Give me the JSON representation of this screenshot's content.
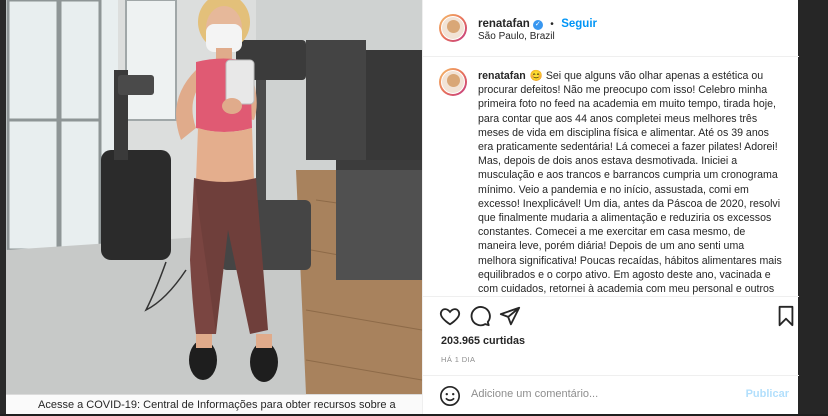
{
  "post": {
    "author": "renatafan",
    "verified_icon": "verified-badge-icon",
    "separator": "•",
    "follow_label": "Seguir",
    "location": "São Paulo, Brazil",
    "caption": "😊 Sei que alguns vão olhar apenas a estética ou procurar defeitos! Não me preocupo com isso! Celebro minha primeira foto no feed na academia em muito tempo, tirada hoje, para contar que aos 44 anos completei meus melhores três meses de vida em disciplina física e alimentar. Até os 39 anos era praticamente sedentária! Lá comecei a fazer pilates! Adorei! Mas, depois de dois anos estava desmotivada. Iniciei a musculação e aos trancos e barrancos cumpria um cronograma mínimo. Veio a pandemia e no início, assustada, comi em excesso! Inexplicável! Um dia, antes da Páscoa de 2020, resolvi que finalmente mudaria a alimentação e reduziria os excessos constantes. Comecei a me exercitar em casa mesmo, de maneira leve, porém diária! Depois de um ano senti uma melhora significativa! Poucas recaídas, hábitos alimentares mais equilibrados e o corpo ativo. Em agosto deste ano, vacinada e com cuidados, retornei à academia com meu personal e outros dias, sozinha. E na última semana completei três meses de",
    "likes": "203.965",
    "likes_label": "curtidas",
    "time_ago": "HÁ 1 DIA",
    "comment_placeholder": "Adicione um comentário...",
    "publish_label": "Publicar"
  },
  "banner": {
    "text": "Acesse a COVID-19: Central de Informações para obter recursos sobre a"
  },
  "icons": {
    "like": "heart-icon",
    "comment": "comment-icon",
    "share": "paper-plane-icon",
    "save": "bookmark-icon",
    "emoji": "emoji-icon"
  },
  "colors": {
    "link": "#0095f6",
    "verified": "#3897f0",
    "publish_disabled": "#b2dffc",
    "muted": "#8e8e8e"
  }
}
